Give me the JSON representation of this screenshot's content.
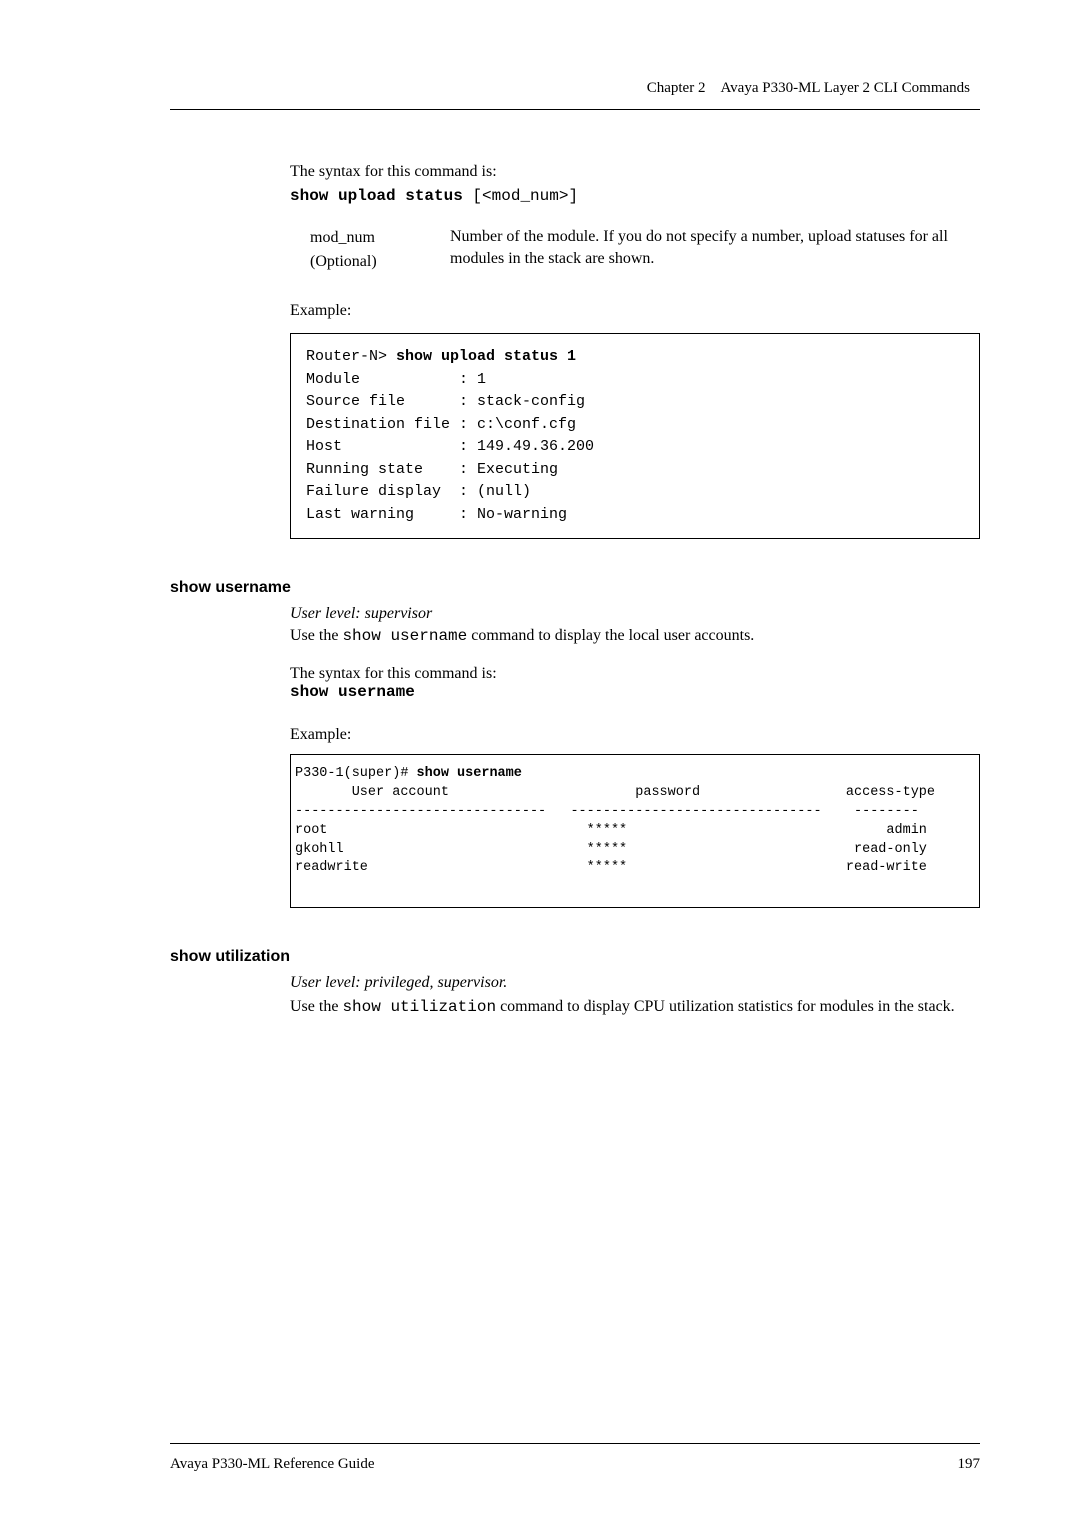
{
  "header": {
    "chapter": "Chapter 2",
    "title": "Avaya P330-ML Layer 2 CLI Commands"
  },
  "syntax_intro": "The syntax for this command is:",
  "upload_cmd": {
    "bold": "show upload status",
    "rest": " [<mod_num>]"
  },
  "param": {
    "name1": "mod_num",
    "name2": "(Optional)",
    "desc": "Number of the module. If you do not specify a number, upload statuses for all modules in the stack are shown."
  },
  "example_label": "Example:",
  "codebox1": {
    "line1a": "Router-N> ",
    "line1b": "show upload status 1",
    "line2": "Module           : 1",
    "line3": "Source file      : stack-config",
    "line4": "Destination file : c:\\conf.cfg",
    "line5": "Host             : 149.49.36.200",
    "line6": "Running state    : Executing",
    "line7": "Failure display  : (null)",
    "line8": "Last warning     : No-warning"
  },
  "section_username": {
    "heading": "show username",
    "userlevel": "User level: supervisor",
    "desc_pre": "Use the ",
    "desc_cmd": "show username",
    "desc_post": " command to display the local user accounts.",
    "cmd": "show username"
  },
  "codebox2": {
    "line1a": "P330-1(super)# ",
    "line1b": "show username",
    "line2": "       User account                       password                  access-type",
    "line3": "-------------------------------   -------------------------------    --------",
    "line4": "root                                *****                                admin",
    "line5": "gkohll                              *****                            read-only",
    "line6": "readwrite                           *****                           read-write",
    "line7": " "
  },
  "section_utilization": {
    "heading": "show utilization",
    "userlevel": "User level: privileged, supervisor.",
    "desc_pre": "Use the ",
    "desc_cmd": "show utilization",
    "desc_post": " command to display CPU utilization statistics for modules in the stack."
  },
  "footer": {
    "left": "Avaya P330-ML Reference Guide",
    "right": "197"
  }
}
